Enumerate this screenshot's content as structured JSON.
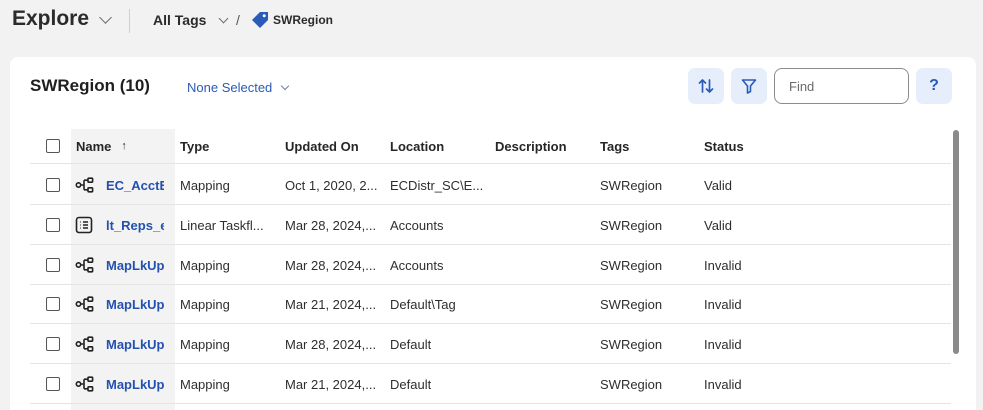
{
  "topbar": {
    "title": "Explore",
    "breadcrumb_all": "All Tags",
    "breadcrumb_sep": "/",
    "breadcrumb_current": "SWRegion"
  },
  "panel": {
    "title": "SWRegion (10)",
    "selection": "None Selected",
    "find_placeholder": "Find",
    "help_label": "?"
  },
  "columns": {
    "name": "Name",
    "name_sort": "↑",
    "type": "Type",
    "updated": "Updated On",
    "location": "Location",
    "description": "Description",
    "tags": "Tags",
    "status": "Status"
  },
  "rows": [
    {
      "icon": "mapping-icon",
      "name": "EC_AcctE:",
      "type": "Mapping",
      "updated": "Oct 1, 2020, 2...",
      "location": "ECDistr_SC\\E...",
      "description": "",
      "tags": "SWRegion",
      "status": "Valid"
    },
    {
      "icon": "taskflow-icon",
      "name": "lt_Reps_ea",
      "type": "Linear Taskfl...",
      "updated": "Mar 28, 2024,...",
      "location": "Accounts",
      "description": "",
      "tags": "SWRegion",
      "status": "Valid"
    },
    {
      "icon": "mapping-icon",
      "name": "MapLkUp:",
      "type": "Mapping",
      "updated": "Mar 28, 2024,...",
      "location": "Accounts",
      "description": "",
      "tags": "SWRegion",
      "status": "Invalid"
    },
    {
      "icon": "mapping-icon",
      "name": "MapLkUp:",
      "type": "Mapping",
      "updated": "Mar 21, 2024,...",
      "location": "Default\\Tag",
      "description": "",
      "tags": "SWRegion",
      "status": "Invalid"
    },
    {
      "icon": "mapping-icon",
      "name": "MapLkUp:",
      "type": "Mapping",
      "updated": "Mar 28, 2024,...",
      "location": "Default",
      "description": "",
      "tags": "SWRegion",
      "status": "Invalid"
    },
    {
      "icon": "mapping-icon",
      "name": "MapLkUp:",
      "type": "Mapping",
      "updated": "Mar 21, 2024,...",
      "location": "Default",
      "description": "",
      "tags": "SWRegion",
      "status": "Invalid"
    }
  ],
  "colors": {
    "accent": "#2a5bb8",
    "link": "#2450b0",
    "button_bg": "#e6eefb",
    "page_bg": "#f2f2f2"
  }
}
